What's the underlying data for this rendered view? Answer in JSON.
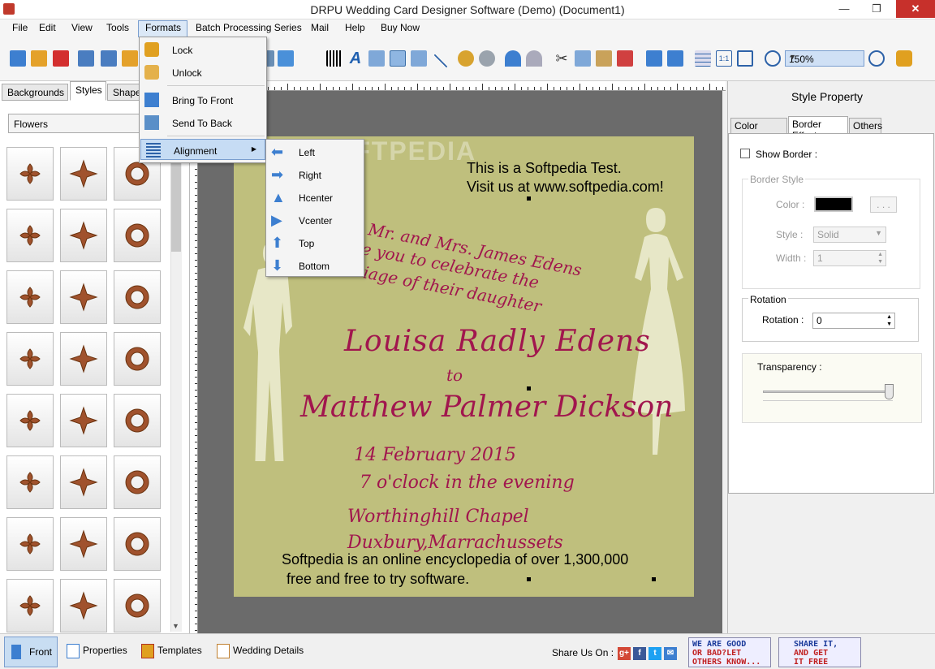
{
  "window": {
    "title": "DRPU Wedding Card Designer Software (Demo) (Document1)"
  },
  "menubar": {
    "items": [
      "File",
      "Edit",
      "View",
      "Tools",
      "Formats",
      "Batch Processing Series",
      "Mail",
      "Help",
      "Buy Now"
    ]
  },
  "toolbar": {
    "zoom_value": "150%"
  },
  "left_panel": {
    "tabs": [
      "Backgrounds",
      "Styles",
      "Shapes"
    ],
    "active_tab": "Styles",
    "category": "Flowers"
  },
  "formats_menu": {
    "items": [
      {
        "label": "Lock",
        "icon": "lock-icon"
      },
      {
        "label": "Unlock",
        "icon": "unlock-icon"
      },
      {
        "label": "Bring To Front",
        "icon": "bring-front-icon"
      },
      {
        "label": "Send To Back",
        "icon": "send-back-icon"
      },
      {
        "label": "Alignment",
        "icon": "alignment-icon"
      }
    ]
  },
  "alignment_menu": {
    "items": [
      {
        "label": "Left",
        "icon": "arrow-left-icon"
      },
      {
        "label": "Right",
        "icon": "arrow-right-icon"
      },
      {
        "label": "Hcenter",
        "icon": "hcenter-icon"
      },
      {
        "label": "Vcenter",
        "icon": "vcenter-icon"
      },
      {
        "label": "Top",
        "icon": "arrow-up-icon"
      },
      {
        "label": "Bottom",
        "icon": "arrow-down-icon"
      }
    ]
  },
  "card": {
    "test_line1": "This is a Softpedia Test.",
    "test_line2": "Visit us at www.softpedia.com!",
    "invite_line1": "Mr. and Mrs. James Edens",
    "invite_line2": "e you to celebrate the",
    "invite_line3": "iage of their daughter",
    "bride": "Louisa Radly Edens",
    "to": "to",
    "groom": "Matthew Palmer Dickson",
    "date": "14 February 2015",
    "time": "7 o'clock in the evening",
    "venue1": "Worthinghill Chapel",
    "venue2": "Duxbury,Marrachussets",
    "footer_line1": "Softpedia is an online encyclopedia of over 1,300,000",
    "footer_line2": "free and free to try software.",
    "watermark": "SOFTPEDIA",
    "background_color": "#bfbf7d",
    "text_color": "#a1164e"
  },
  "style_property": {
    "title": "Style Property",
    "tabs": [
      "Color Effects",
      "Border Effect",
      "Others"
    ],
    "active_tab": "Border Effect",
    "show_border_label": "Show Border :",
    "border_style_label": "Border Style",
    "color_label": "Color :",
    "color_button": ". . .",
    "style_label": "Style :",
    "style_value": "Solid",
    "width_label": "Width :",
    "width_value": "1",
    "rotation_group": "Rotation",
    "rotation_label": "Rotation :",
    "rotation_value": "0",
    "transparency_label": "Transparency :"
  },
  "statusbar": {
    "front": "Front",
    "properties": "Properties",
    "templates": "Templates",
    "wedding_details": "Wedding Details",
    "share_label": "Share Us On :",
    "promo1_line1": "WE ARE GOOD",
    "promo1_line2": "OR BAD?LET",
    "promo1_line3": "OTHERS KNOW...",
    "promo2_line1": "SHARE IT,",
    "promo2_line2": "AND GET",
    "promo2_line3": "IT FREE"
  }
}
